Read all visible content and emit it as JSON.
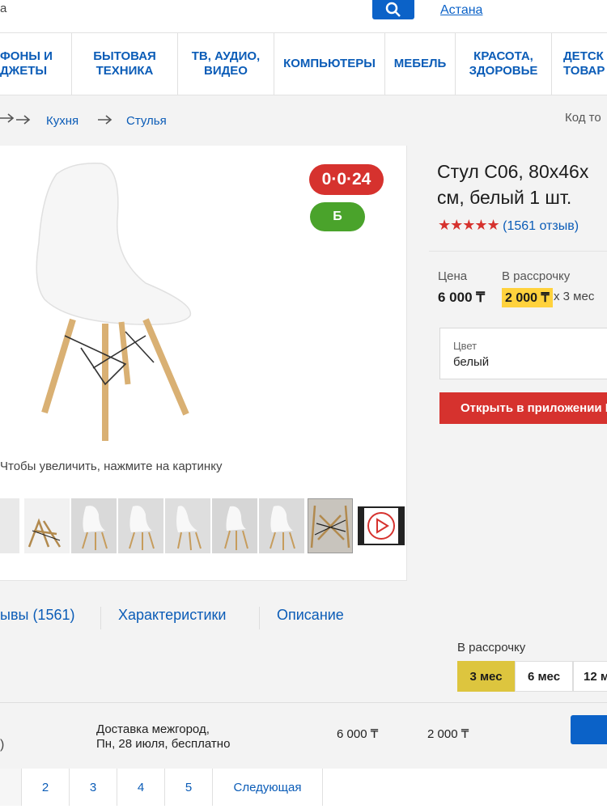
{
  "header": {
    "city": "Астана",
    "partial_left": "а"
  },
  "nav": [
    "ФОНЫ И\nДЖЕТЫ",
    "БЫТОВАЯ\nТЕХНИКА",
    "ТВ, АУДИО,\nВИДЕО",
    "КОМПЬЮТЕРЫ",
    "МЕБЕЛЬ",
    "КРАСОТА,\nЗДОРОВЬЕ",
    "ДЕТСК\nТОВАР"
  ],
  "breadcrumbs": [
    "Кухня",
    "Стулья"
  ],
  "product_code_label": "Код то",
  "badges": {
    "installment": "0·0·24",
    "bonus": "Б"
  },
  "zoom_hint": "Чтобы увеличить, нажмите на картинку",
  "product": {
    "title_line1": "Стул С06, 80х46х",
    "title_line2": "см, белый 1 шт.",
    "rating_stars": 5,
    "reviews": "(1561 отзыв)",
    "price_label": "Цена",
    "price": "6 000 ₸",
    "installment_label": "В рассрочку",
    "installment_price": "2 000 ₸",
    "installment_months": "х 3 мес",
    "color_label": "Цвет",
    "color_value": "белый",
    "open_app": "Открыть в приложении K"
  },
  "tabs": [
    "ывы (1561)",
    "Характеристики",
    "Описание"
  ],
  "credit": {
    "label": "В рассрочку",
    "terms": [
      "3 мес",
      "6 мес",
      "12 м"
    ]
  },
  "offer": {
    "delivery_line1": "Доставка межгород,",
    "delivery_line2": "Пн, 28 июля, бесплатно",
    "price": "6 000 ₸",
    "monthly": "2 000 ₸",
    "left_paren": ")"
  },
  "pagination": [
    "2",
    "3",
    "4",
    "5",
    "Следующая"
  ],
  "colors": {
    "brand_blue": "#0b5cb7",
    "red": "#d6322e",
    "green": "#4aa32b",
    "yellow": "#ffd23d"
  }
}
